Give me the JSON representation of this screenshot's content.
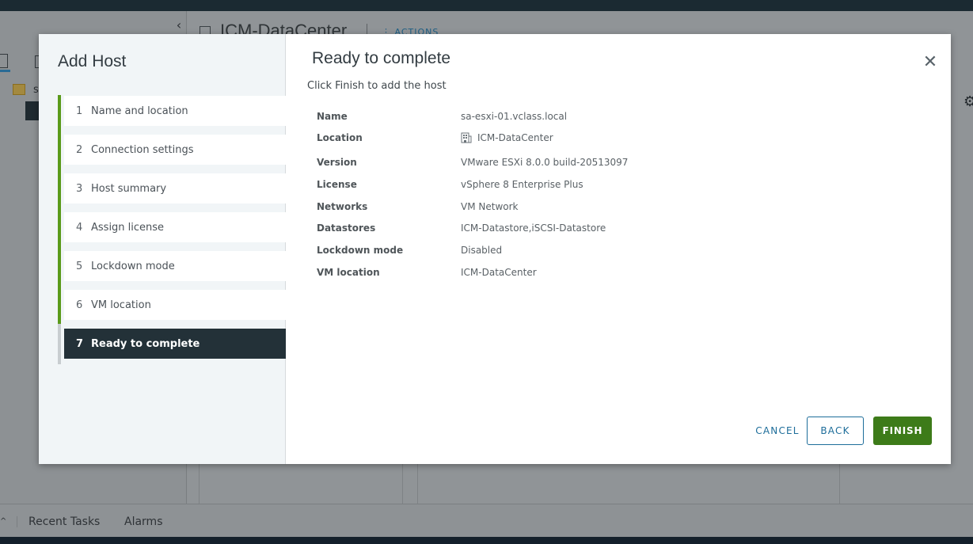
{
  "background": {
    "title": "ICM-DataCenter",
    "actions_label": "ACTIONS",
    "tree_item_label": "s",
    "bottom_tabs": [
      "Recent Tasks",
      "Alarms"
    ]
  },
  "dialog": {
    "title": "Add Host",
    "steps": [
      {
        "number": "1",
        "label": "Name and location"
      },
      {
        "number": "2",
        "label": "Connection settings"
      },
      {
        "number": "3",
        "label": "Host summary"
      },
      {
        "number": "4",
        "label": "Assign license"
      },
      {
        "number": "5",
        "label": "Lockdown mode"
      },
      {
        "number": "6",
        "label": "VM location"
      },
      {
        "number": "7",
        "label": "Ready to complete"
      }
    ],
    "active_step": 7,
    "page_title": "Ready to complete",
    "subtitle": "Click Finish to add the host",
    "summary": [
      {
        "label": "Name",
        "value": "sa-esxi-01.vclass.local"
      },
      {
        "label": "Location",
        "value": "ICM-DataCenter",
        "icon": "datacenter-icon"
      },
      {
        "label": "Version",
        "value": "VMware ESXi 8.0.0 build-20513097"
      },
      {
        "label": "License",
        "value": "vSphere 8 Enterprise Plus"
      },
      {
        "label": "Networks",
        "value": "VM Network"
      },
      {
        "label": "Datastores",
        "value": "ICM-Datastore,iSCSI-Datastore"
      },
      {
        "label": "Lockdown mode",
        "value": "Disabled"
      },
      {
        "label": "VM location",
        "value": "ICM-DataCenter"
      }
    ],
    "buttons": {
      "cancel": "CANCEL",
      "back": "BACK",
      "finish": "FINISH"
    }
  },
  "colors": {
    "accent": "#1d6d9a",
    "finish_green": "#3d7b19",
    "progress_green": "#5a9a1a",
    "active_step_bg": "#233138"
  }
}
